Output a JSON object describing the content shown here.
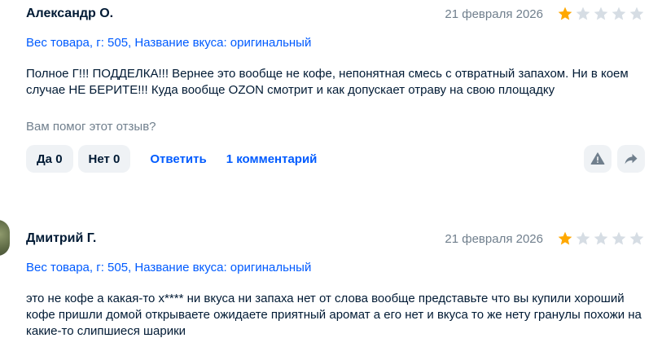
{
  "reviews": [
    {
      "author": "Александр О.",
      "date": "21 февраля 2026",
      "rating": 1,
      "max_rating": 5,
      "meta": "Вес товара, г: 505, Название вкуса: оригинальный",
      "text": "Полное Г!!! ПОДДЕЛКА!!! Вернее это вообще не кофе, непонятная смесь с отвратный запахом. Ни в коем случае НЕ БЕРИТЕ!!! Куда вообще OZON смотрит и как допускает отраву на свою площадку",
      "helpful_question": "Вам помог этот отзыв?",
      "yes_label": "Да 0",
      "no_label": "Нет 0",
      "reply_label": "Ответить",
      "comments_label": "1 комментарий"
    },
    {
      "author": "Дмитрий Г.",
      "date": "21 февраля 2026",
      "rating": 1,
      "max_rating": 5,
      "meta": "Вес товара, г: 505, Название вкуса: оригинальный",
      "text": "это не кофе а какая-то х**** ни вкуса ни запаха нет от слова вообще представьте что вы купили хороший кофе пришли домой открываете ожидаете приятный аромат а его нет и вкуса то же нету гранулы похожи на какие-то слипшиеся шарики"
    }
  ],
  "icons": {
    "star_filled": "star-icon",
    "star_empty": "star-empty-icon",
    "report": "warning-icon",
    "share": "share-arrow-icon"
  },
  "colors": {
    "star_filled": "#ffa800",
    "star_empty": "#d6dde4",
    "link": "#005bff",
    "muted": "#707f8d",
    "button_bg": "#eff2f5"
  }
}
